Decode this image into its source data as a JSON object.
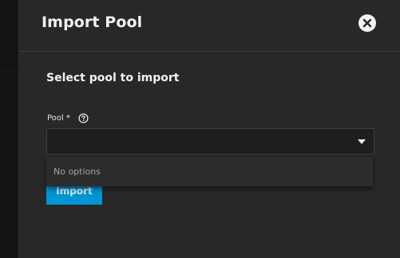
{
  "dialog": {
    "title": "Import Pool",
    "close_icon": "close-icon"
  },
  "form": {
    "section_title": "Select pool to import",
    "pool_field": {
      "label": "Pool",
      "required_marker": "*",
      "help_icon": "help-circle-icon",
      "value": "",
      "dropdown_icon": "triangle-down-icon",
      "options_empty_text": "No options"
    },
    "import_button": "Import"
  },
  "colors": {
    "accent": "#0095d5",
    "panel_bg": "#282828",
    "page_bg": "#111111"
  }
}
